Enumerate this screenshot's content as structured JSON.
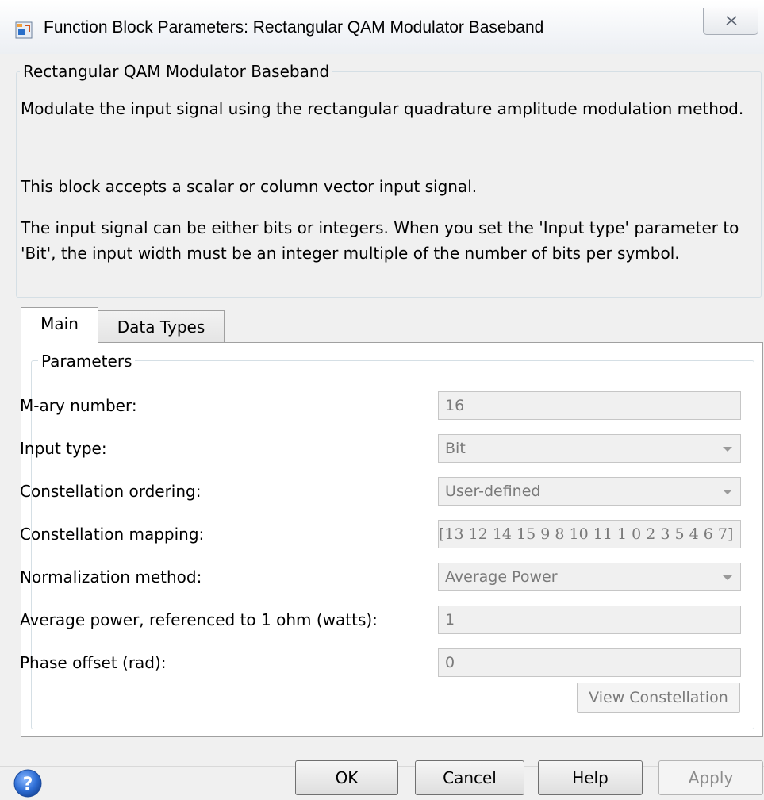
{
  "window": {
    "title": "Function Block Parameters: Rectangular QAM Modulator Baseband",
    "app_icon": "simulink-block-icon",
    "close_icon": "close-icon"
  },
  "description": {
    "group_title": "Rectangular QAM Modulator Baseband",
    "paragraphs": [
      "Modulate the input signal using the rectangular quadrature amplitude modulation method.",
      "This block accepts a scalar or column vector input signal.",
      "The input signal can be either bits or integers. When you set the 'Input type' parameter to 'Bit', the input width must be an integer multiple of the number of bits per symbol."
    ]
  },
  "tabs": [
    {
      "label": "Main",
      "active": true
    },
    {
      "label": "Data Types",
      "active": false
    }
  ],
  "parameters": {
    "group_title": "Parameters",
    "fields": [
      {
        "label": "M-ary number:",
        "value": "16",
        "kind": "text"
      },
      {
        "label": "Input type:",
        "value": "Bit",
        "kind": "select"
      },
      {
        "label": "Constellation ordering:",
        "value": "User-defined",
        "kind": "select"
      },
      {
        "label": "Constellation mapping:",
        "value": "[13 12 14 15 9 8 10 11 1 0 2 3 5 4 6 7]",
        "kind": "text"
      },
      {
        "label": "Normalization method:",
        "value": "Average Power",
        "kind": "select"
      },
      {
        "label": "Average power, referenced to 1 ohm (watts):",
        "value": "1",
        "kind": "text"
      },
      {
        "label": "Phase offset (rad):",
        "value": "0",
        "kind": "text"
      }
    ],
    "view_button": "View Constellation"
  },
  "footer": {
    "help_icon": "help-question-icon",
    "ok": "OK",
    "cancel": "Cancel",
    "help": "Help",
    "apply": "Apply"
  }
}
